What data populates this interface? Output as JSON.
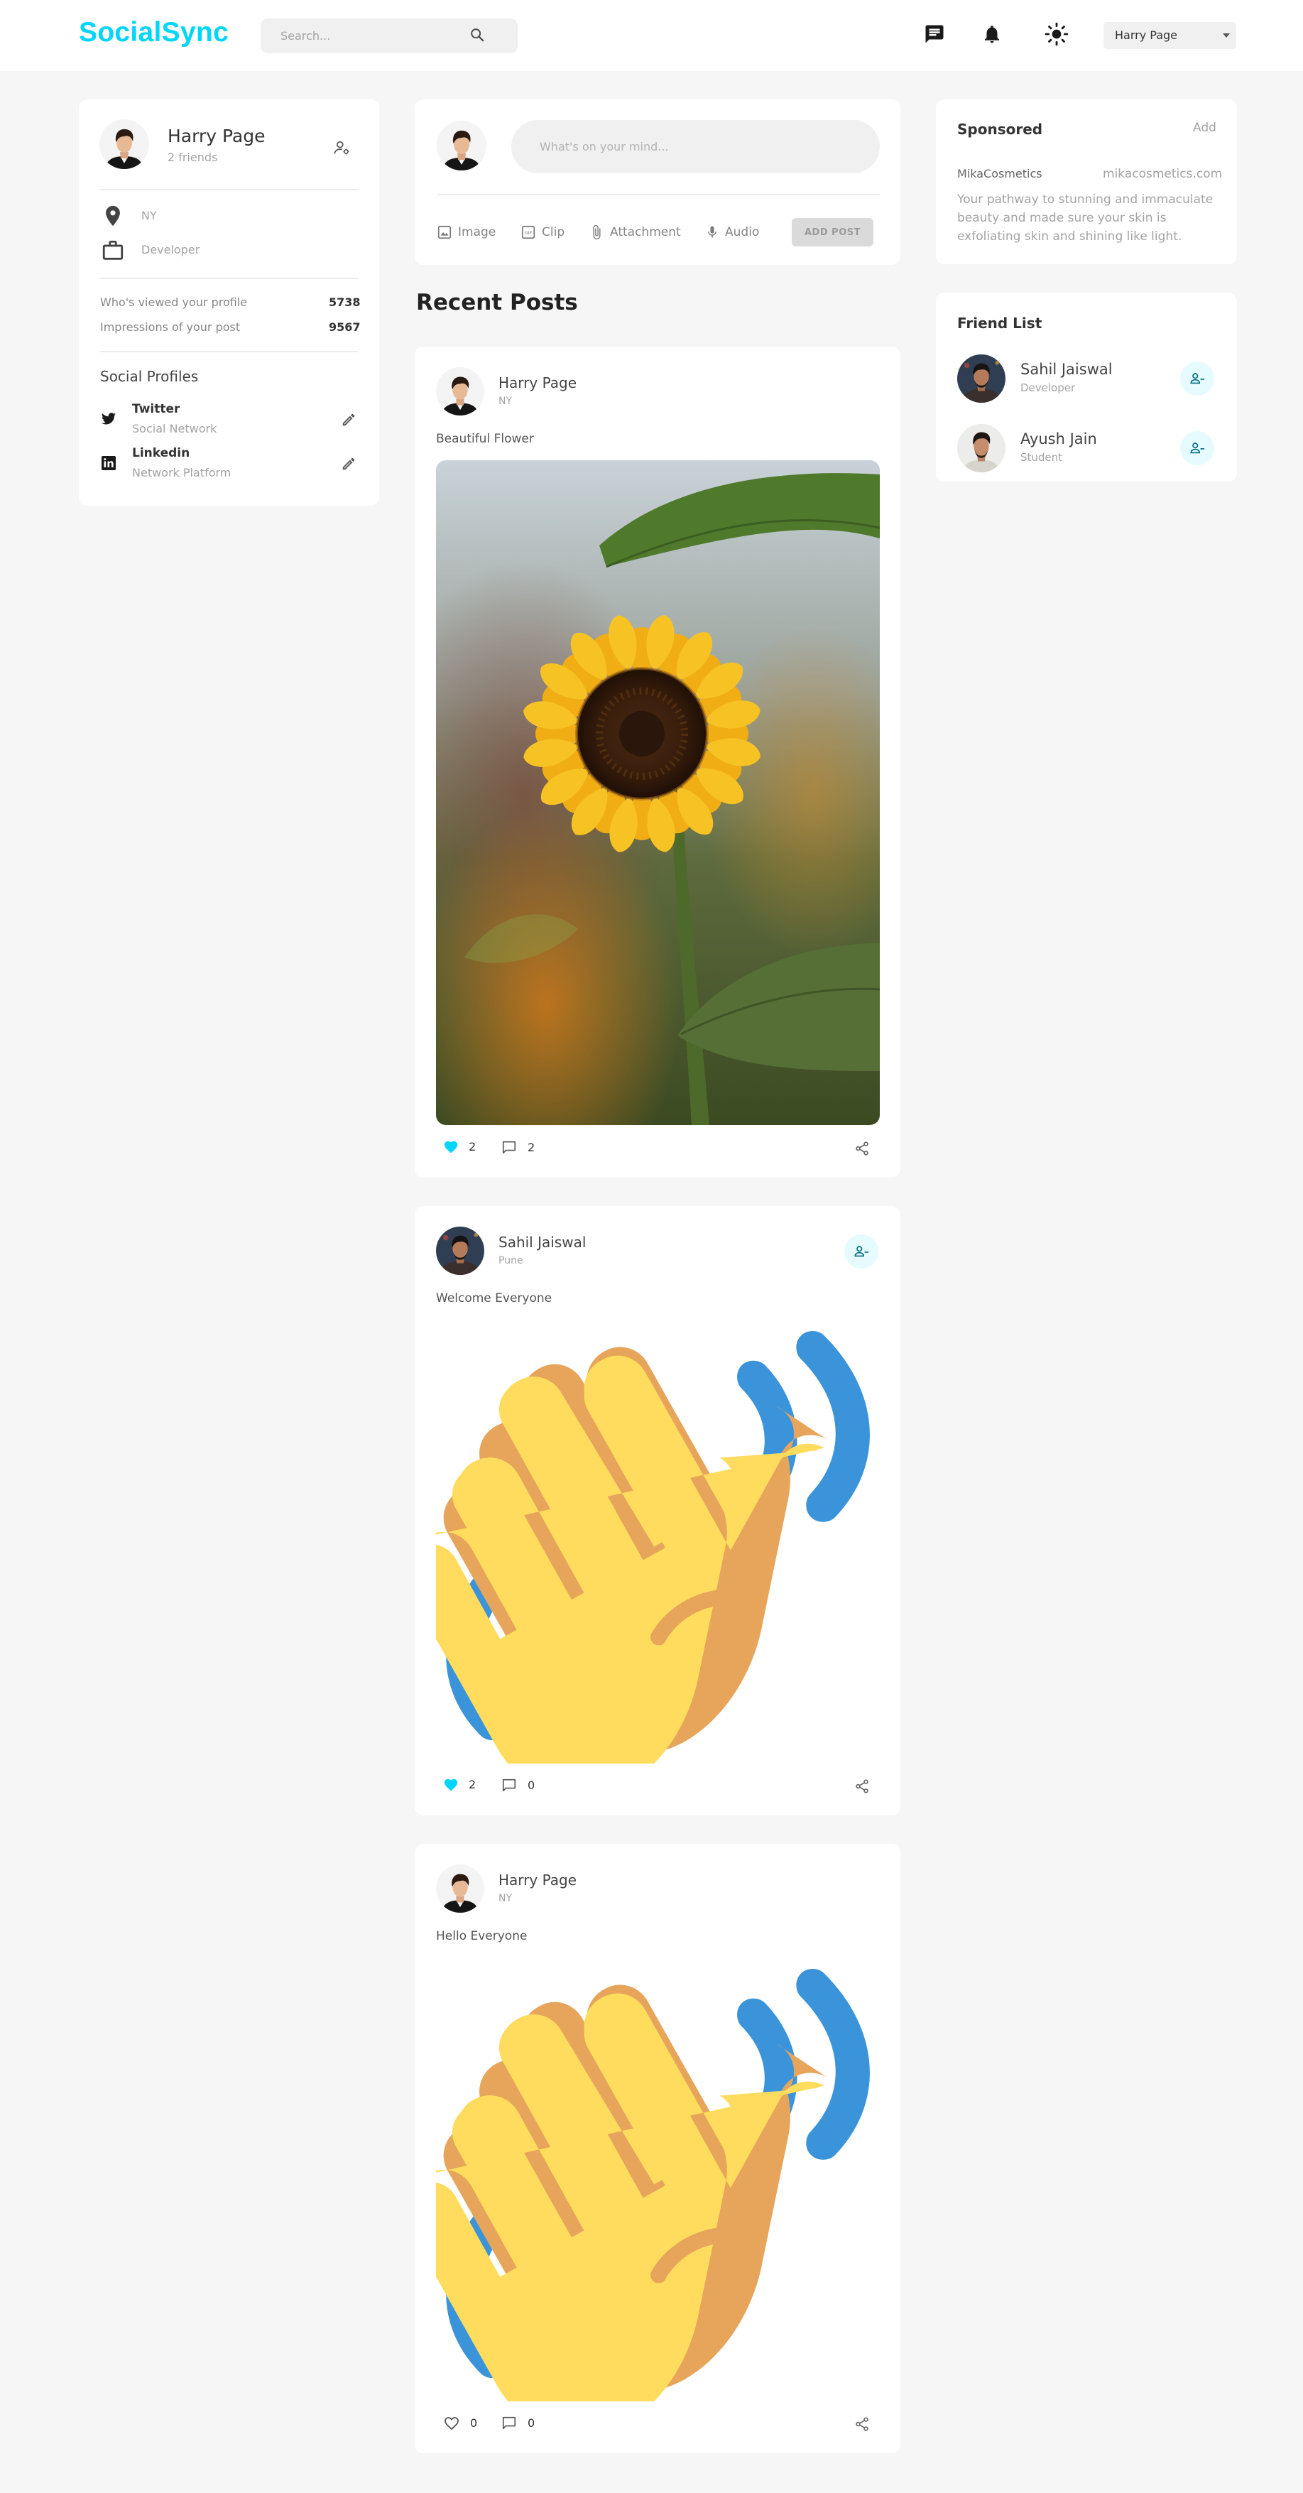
{
  "app": {
    "logo": "SocialSync"
  },
  "navbar": {
    "search_placeholder": "Search...",
    "user_name": "Harry Page",
    "brand_color": "#00D5FA"
  },
  "profile": {
    "name": "Harry Page",
    "friends": "2 friends",
    "location": "NY",
    "occupation": "Developer",
    "stats": [
      {
        "label": "Who's viewed your profile",
        "value": "5738"
      },
      {
        "label": "Impressions of your post",
        "value": "9567"
      }
    ],
    "social_title": "Social Profiles",
    "socials": [
      {
        "name": "Twitter",
        "sub": "Social Network",
        "icon": "twitter-icon"
      },
      {
        "name": "Linkedin",
        "sub": "Network Platform",
        "icon": "linkedin-icon"
      }
    ]
  },
  "composer": {
    "placeholder": "What's on your mind...",
    "tools": [
      {
        "label": "Image",
        "icon": "image-icon"
      },
      {
        "label": "Clip",
        "icon": "gif-icon"
      },
      {
        "label": "Attachment",
        "icon": "paperclip-icon"
      },
      {
        "label": "Audio",
        "icon": "microphone-icon"
      }
    ],
    "button": "ADD POST"
  },
  "feed": {
    "heading": "Recent Posts",
    "posts": [
      {
        "author": "Harry Page",
        "location": "NY",
        "text": "Beautiful Flower",
        "likes": "2",
        "comments": "2",
        "liked": true,
        "image": "sunflower"
      },
      {
        "author": "Sahil Jaiswal",
        "location": "Pune",
        "text": "Welcome Everyone",
        "likes": "2",
        "comments": "0",
        "liked": true,
        "image": "waving-hand"
      },
      {
        "author": "Harry Page",
        "location": "NY",
        "text": "Hello Everyone",
        "likes": "0",
        "comments": "0",
        "liked": false,
        "image": "waving-hand"
      }
    ]
  },
  "sponsored": {
    "title": "Sponsored",
    "action": "Add",
    "name": "MikaCosmetics",
    "url": "mikacosmetics.com",
    "description": "Your pathway to stunning and immaculate beauty and made sure your skin is exfoliating skin and shining like light."
  },
  "friends": {
    "title": "Friend List",
    "list": [
      {
        "name": "Sahil Jaiswal",
        "role": "Developer"
      },
      {
        "name": "Ayush Jain",
        "role": "Student"
      }
    ]
  }
}
